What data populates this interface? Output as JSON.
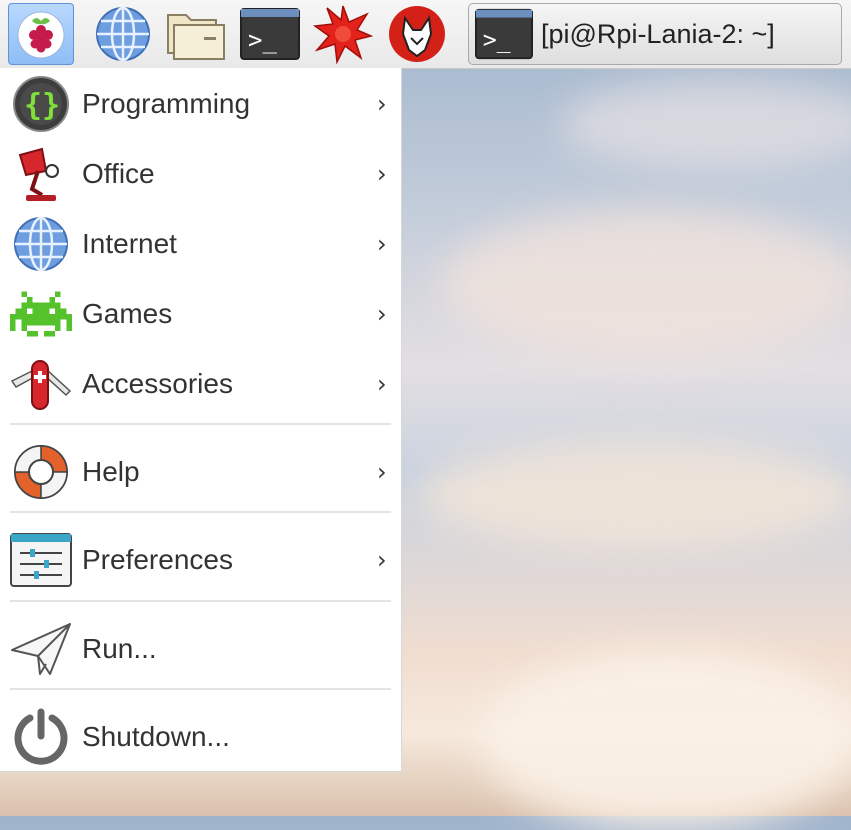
{
  "taskbar": {
    "launchers": [
      {
        "name": "raspberry-menu-icon"
      },
      {
        "name": "web-browser-icon"
      },
      {
        "name": "file-manager-icon"
      },
      {
        "name": "terminal-icon"
      },
      {
        "name": "mathematica-icon"
      },
      {
        "name": "wolfram-icon"
      }
    ],
    "task": {
      "title": "[pi@Rpi-Lania-2: ~]",
      "icon": "terminal-icon"
    }
  },
  "menu": {
    "items": [
      {
        "label": "Programming",
        "icon": "programming-icon",
        "submenu": true
      },
      {
        "label": "Office",
        "icon": "office-lamp-icon",
        "submenu": true
      },
      {
        "label": "Internet",
        "icon": "globe-icon",
        "submenu": true
      },
      {
        "label": "Games",
        "icon": "space-invader-icon",
        "submenu": true
      },
      {
        "label": "Accessories",
        "icon": "pocket-knife-icon",
        "submenu": true
      },
      {
        "label": "Help",
        "icon": "lifebuoy-icon",
        "submenu": true
      },
      {
        "label": "Preferences",
        "icon": "preferences-icon",
        "submenu": true
      },
      {
        "label": "Run...",
        "icon": "paper-plane-icon",
        "submenu": false
      },
      {
        "label": "Shutdown...",
        "icon": "power-icon",
        "submenu": false
      }
    ],
    "chevron": "›"
  },
  "colors": {
    "menu_button_bg": "#9cc7fa",
    "raspberry": "#c51a4a",
    "leaf": "#6cc04a",
    "icon_dark": "#3b3b3b"
  }
}
